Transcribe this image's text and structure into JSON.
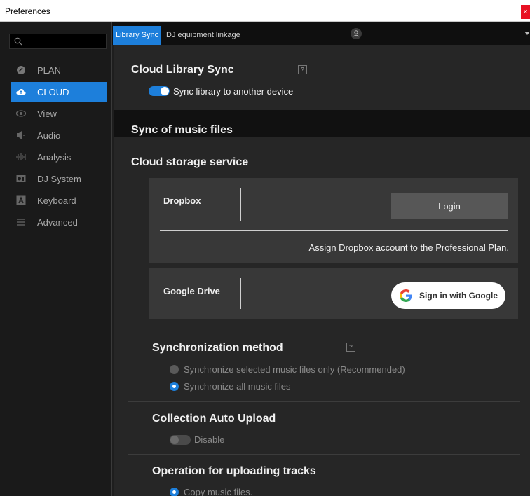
{
  "window": {
    "title": "Preferences",
    "close_label": "×"
  },
  "sidebar": {
    "search_placeholder": "",
    "items": [
      {
        "label": "PLAN",
        "icon": "plan-icon"
      },
      {
        "label": "CLOUD",
        "icon": "cloud-icon",
        "active": true
      },
      {
        "label": "View",
        "icon": "eye-icon"
      },
      {
        "label": "Audio",
        "icon": "speaker-icon"
      },
      {
        "label": "Analysis",
        "icon": "waveform-icon"
      },
      {
        "label": "DJ System",
        "icon": "dj-system-icon"
      },
      {
        "label": "Keyboard",
        "icon": "keyboard-icon"
      },
      {
        "label": "Advanced",
        "icon": "menu-lines-icon"
      }
    ]
  },
  "tabs": [
    {
      "label": "Library Sync",
      "active": true
    },
    {
      "label": "DJ equipment linkage",
      "active": false
    }
  ],
  "cloud_library_sync": {
    "title": "Cloud Library Sync",
    "help": "?",
    "toggle_label": "Sync library to another device",
    "toggle_on": true
  },
  "sync_music": {
    "title": "Sync of music files"
  },
  "cloud_storage": {
    "title": "Cloud storage service",
    "dropbox": {
      "name": "Dropbox",
      "login_label": "Login",
      "note": "Assign Dropbox account to the Professional Plan."
    },
    "google": {
      "name": "Google Drive",
      "signin_label": "Sign in with Google"
    }
  },
  "sync_method": {
    "title": "Synchronization method",
    "help": "?",
    "options": [
      {
        "label": "Synchronize selected music files only (Recommended)",
        "selected": false
      },
      {
        "label": "Synchronize all music files",
        "selected": true
      }
    ]
  },
  "auto_upload": {
    "title": "Collection Auto Upload",
    "toggle_label": "Disable",
    "toggle_on": false
  },
  "uploading": {
    "title": "Operation for uploading tracks",
    "option_label": "Copy music files."
  },
  "colors": {
    "accent": "#1d7fdb",
    "background": "#262626",
    "sidebar": "#1a1a1a"
  }
}
